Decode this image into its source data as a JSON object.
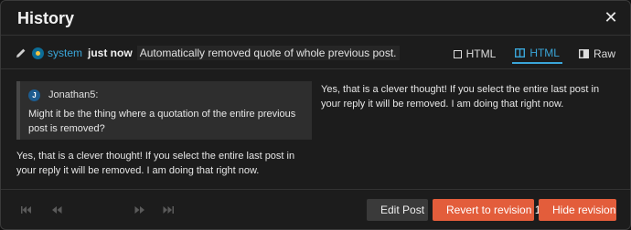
{
  "modal": {
    "title": "History"
  },
  "meta": {
    "username": "system",
    "time": "just now",
    "edit_reason": "Automatically removed quote of whole previous post."
  },
  "tabs": [
    {
      "label": "HTML",
      "icon": "square-icon",
      "active": false
    },
    {
      "label": "HTML",
      "icon": "columns-icon",
      "active": true
    },
    {
      "label": "Raw",
      "icon": "raw-icon",
      "active": false
    }
  ],
  "previous": {
    "quote_user": "Jonathan5:",
    "quote_avatar_letter": "J",
    "quote_text": "Might it be the thing where a quotation of the entire previous post is removed?",
    "reply_text": "Yes, that is a clever thought! If you select the entire last post in your reply it will be removed. I am doing that right now."
  },
  "current": {
    "text": "Yes, that is a clever thought! If you select the entire last post in your reply it will be removed. I am doing that right now."
  },
  "footer": {
    "nav": [
      "first-revision-icon",
      "previous-revision-icon",
      "next-revision-icon",
      "last-revision-icon"
    ],
    "edit_post_label": "Edit Post",
    "revert_label": "Revert to revision 1",
    "hide_label": "Hide revision"
  },
  "colors": {
    "accent": "#3aa6d9",
    "danger": "#e35d3b",
    "background": "#1c1c1c"
  }
}
